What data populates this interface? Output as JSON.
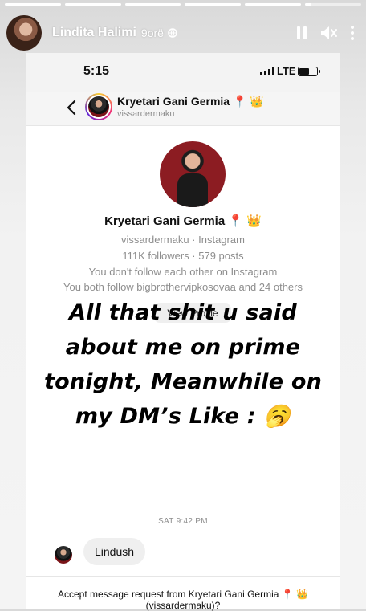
{
  "story": {
    "segments": [
      1,
      1,
      1,
      1,
      1,
      0.1
    ],
    "username": "Lindita Halimi",
    "time": "9orë",
    "controls": {
      "pause": "pause-icon",
      "mute": "speaker-muted-icon",
      "more": "more-icon"
    }
  },
  "screenshot": {
    "status": {
      "time": "5:15",
      "network": "LTE"
    },
    "chat": {
      "name": "Kryetari Gani Germia 📍 👑",
      "handle": "vissardermaku"
    },
    "profile": {
      "name": "Kryetari Gani Germia 📍 👑",
      "line1": "vissardermaku · Instagram",
      "line2": "111K followers · 579 posts",
      "line3": "You don't follow each other on Instagram",
      "line4": "You both follow bigbrothervipkosovaa and 24 others",
      "view_button": "View Profile"
    },
    "date_stamp": "SAT 9:42 PM",
    "message": "Lindush",
    "accept_text": "Accept message request from Kryetari Gani Germia 📍 👑 (vissardermaku)?"
  },
  "overlay": {
    "line1": "All that shit u said",
    "line2": "about me on prime",
    "line3": "tonight, Meanwhile on",
    "line4": "my DM’s Like : 🥱"
  }
}
